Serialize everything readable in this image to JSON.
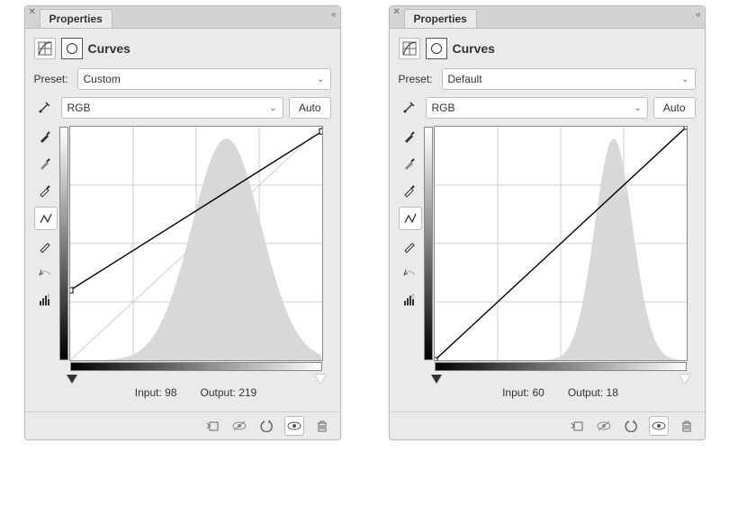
{
  "panels": [
    {
      "tab": "Properties",
      "title": "Curves",
      "preset_label": "Preset:",
      "preset_value": "Custom",
      "channel_value": "RGB",
      "auto_label": "Auto",
      "input_label": "Input:",
      "input_value": "98",
      "output_label": "Output:",
      "output_value": "219",
      "histogram_peak_x_frac": 0.62,
      "histogram_spread": 0.55,
      "histogram_height_frac": 0.95,
      "curve_start_y_frac": 0.7,
      "curve_end_y_frac": 0.02
    },
    {
      "tab": "Properties",
      "title": "Curves",
      "preset_label": "Preset:",
      "preset_value": "Default",
      "channel_value": "RGB",
      "auto_label": "Auto",
      "input_label": "Input:",
      "input_value": "60",
      "output_label": "Output:",
      "output_value": "18",
      "histogram_peak_x_frac": 0.71,
      "histogram_spread": 0.3,
      "histogram_height_frac": 0.95,
      "curve_start_y_frac": 1.0,
      "curve_end_y_frac": 0.0
    }
  ],
  "tools": {
    "target": "on-image-adjust",
    "black_eyedrop": "black-point-eyedropper",
    "gray_eyedrop": "gray-point-eyedropper",
    "white_eyedrop": "white-point-eyedropper",
    "curve_points": "curve-point-tool",
    "pencil": "draw-curve-pencil",
    "smooth": "smooth-curve",
    "histogram": "histogram-options"
  },
  "footer": {
    "clip": "clip-to-layer",
    "view_prev": "view-previous",
    "reset": "reset",
    "visibility": "toggle-visibility",
    "delete": "delete"
  }
}
